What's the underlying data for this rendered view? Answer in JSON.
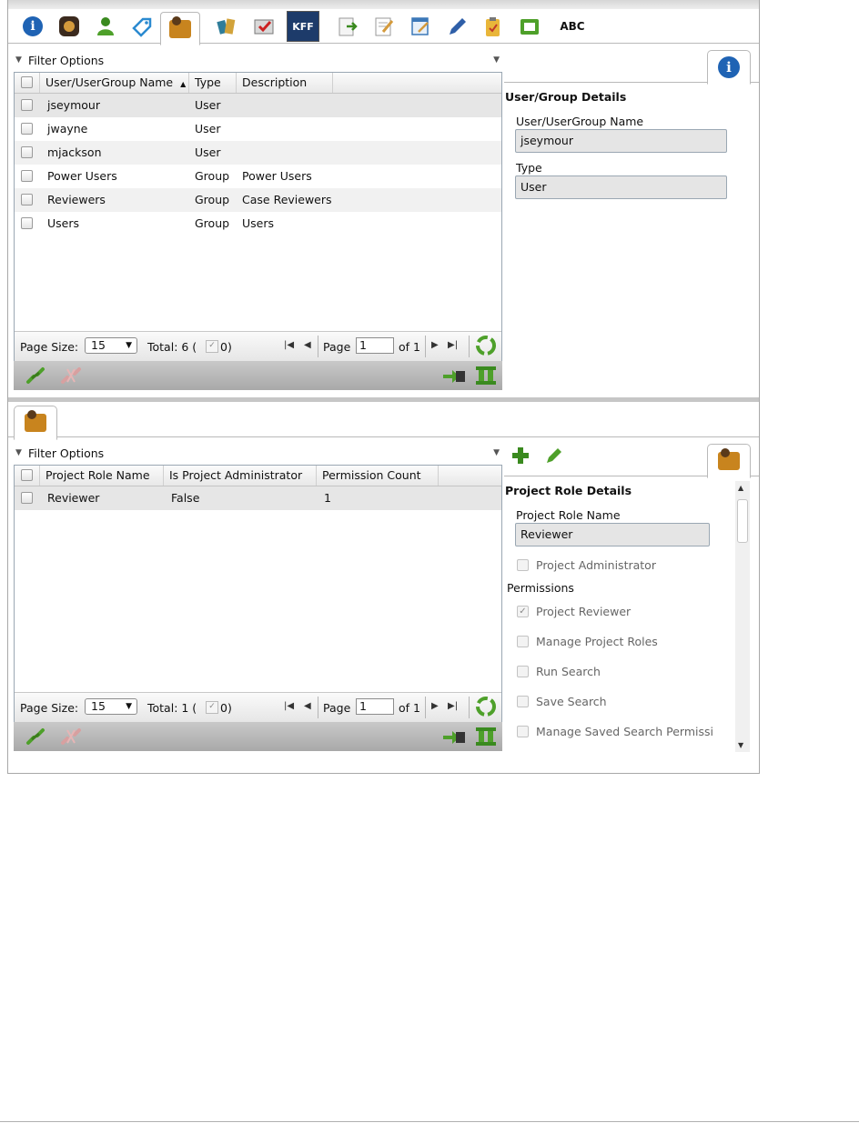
{
  "toolbar": {
    "icons": [
      "info-icon",
      "media-icon",
      "user-icon",
      "tag-icon",
      "project-roles-icon",
      "books-icon",
      "map-icon",
      "kff-icon",
      "export-icon",
      "notes-icon",
      "edit-form-icon",
      "pen-icon",
      "clipboard-icon",
      "film-icon",
      "spell-check-icon"
    ],
    "kff_label": "KFF",
    "abc_label": "ABC"
  },
  "top_panel": {
    "filter_label": "Filter Options",
    "columns": [
      "User/UserGroup Name",
      "Type",
      "Description"
    ],
    "sort_indicator": "▲",
    "rows": [
      {
        "name": "jseymour",
        "type": "User",
        "description": ""
      },
      {
        "name": "jwayne",
        "type": "User",
        "description": ""
      },
      {
        "name": "mjackson",
        "type": "User",
        "description": ""
      },
      {
        "name": "Power Users",
        "type": "Group",
        "description": "Power Users"
      },
      {
        "name": "Reviewers",
        "type": "Group",
        "description": "Case Reviewers"
      },
      {
        "name": "Users",
        "type": "Group",
        "description": "Users"
      }
    ],
    "pager": {
      "page_size_label": "Page Size:",
      "page_size": "15",
      "total_label": "Total: 6 (",
      "checked_count": "0)",
      "page_label": "Page",
      "page": "1",
      "of_label": "of 1"
    },
    "details": {
      "title": "User/Group Details",
      "name_label": "User/UserGroup Name",
      "name_value": "jseymour",
      "type_label": "Type",
      "type_value": "User"
    }
  },
  "bottom_panel": {
    "filter_label": "Filter Options",
    "columns": [
      "Project Role Name",
      "Is Project Administrator",
      "Permission Count"
    ],
    "rows": [
      {
        "name": "Reviewer",
        "is_admin": "False",
        "count": "1"
      }
    ],
    "pager": {
      "page_size_label": "Page Size:",
      "page_size": "15",
      "total_label": "Total: 1 (",
      "checked_count": "0)",
      "page_label": "Page",
      "page": "1",
      "of_label": "of 1"
    },
    "details": {
      "title": "Project Role Details",
      "name_label": "Project Role Name",
      "name_value": "Reviewer",
      "admin_label": "Project Administrator",
      "permissions_label": "Permissions",
      "permissions": [
        {
          "label": "Project Reviewer",
          "checked": true
        },
        {
          "label": "Manage Project Roles",
          "checked": false
        },
        {
          "label": "Run Search",
          "checked": false
        },
        {
          "label": "Save Search",
          "checked": false
        },
        {
          "label": "Manage Saved Search Permissi",
          "checked": false
        }
      ]
    }
  },
  "colors": {
    "accent_blue": "#1f63b4",
    "green": "#3a8a1f",
    "orange": "#c8841e"
  }
}
